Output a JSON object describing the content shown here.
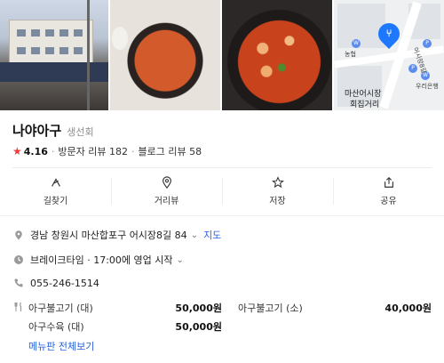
{
  "photos": [
    {
      "icon": "storefront-photo"
    },
    {
      "icon": "food-photo-1"
    },
    {
      "icon": "food-photo-2"
    },
    {
      "icon": "map-thumbnail"
    }
  ],
  "map": {
    "labels": [
      "농협",
      "어시장8길",
      "마산어시장",
      "회집거리",
      "우리은행"
    ]
  },
  "place": {
    "name": "나야아구",
    "category": "생선회",
    "rating": "4.16",
    "visitor_reviews": "방문자 리뷰 182",
    "blog_reviews": "블로그 리뷰 58"
  },
  "actions": [
    {
      "label": "길찾기",
      "icon": "directions-icon"
    },
    {
      "label": "거리뷰",
      "icon": "pin-icon"
    },
    {
      "label": "저장",
      "icon": "star-icon"
    },
    {
      "label": "공유",
      "icon": "share-icon"
    }
  ],
  "info": {
    "address": "경남 창원시 마산합포구 어시장8길 84",
    "map_link": "지도",
    "hours": "브레이크타임 · 17:00에 영업 시작",
    "phone": "055-246-1514"
  },
  "menu": {
    "items": [
      {
        "name": "아구불고기 (대)",
        "price": "50,000원"
      },
      {
        "name": "아구불고기 (소)",
        "price": "40,000원"
      },
      {
        "name": "아구수육 (대)",
        "price": "50,000원"
      }
    ],
    "more": "메뉴판 전체보기"
  },
  "colors": {
    "accent": "#2b64d9",
    "star": "#f03b3b",
    "pin": "#1e78ff"
  }
}
